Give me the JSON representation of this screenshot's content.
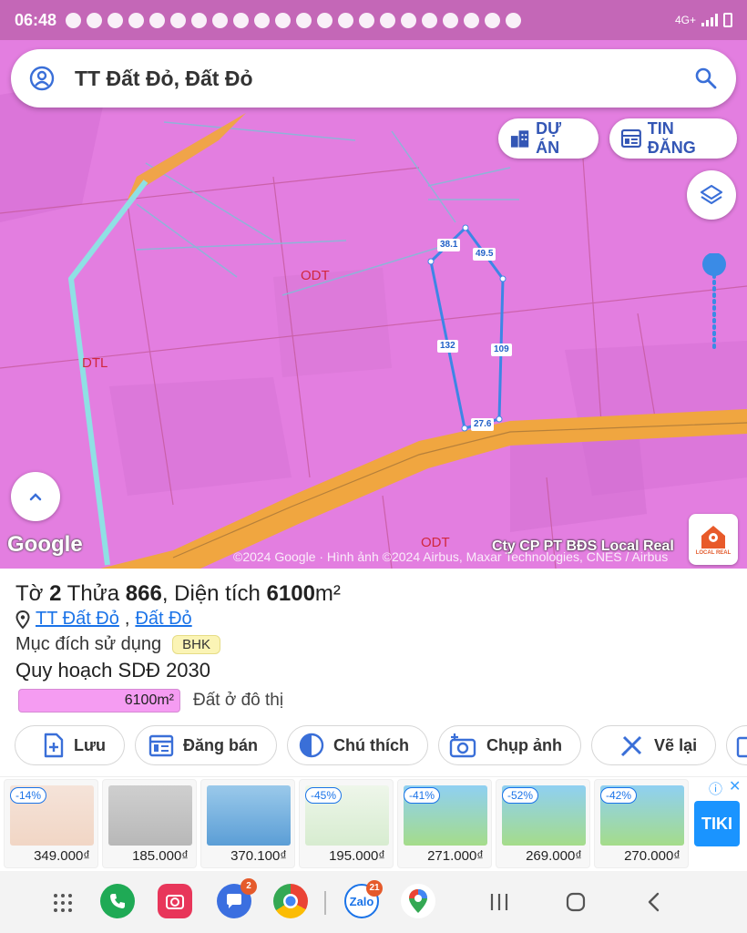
{
  "status_bar": {
    "time": "06:48",
    "network": "4G+"
  },
  "search": {
    "query": "TT Đất Đỏ, Đất Đỏ"
  },
  "top_buttons": {
    "du_an": "DỰ ÁN",
    "tin_dang": "TIN ĐĂNG"
  },
  "map": {
    "zone_labels": [
      "ODT",
      "DTL",
      "ODT"
    ],
    "segment_labels": [
      "38.1",
      "49.5",
      "132",
      "109",
      "27.6"
    ],
    "google": "Google",
    "attribution": "©2024 Google · Hình ảnh ©2024 Airbus, Maxar Technologies, CNES / Airbus",
    "watermark": "Cty CP PT BĐS Local Real",
    "logo_text": "LOCAL REAL"
  },
  "parcel": {
    "to_label": "Tờ",
    "to_value": "2",
    "thua_label": "Thửa",
    "thua_value": "866",
    "area_label": ", Diện tích",
    "area_value": "6100",
    "area_unit": "m²",
    "location_1": "TT Đất Đỏ",
    "location_sep": ",",
    "location_2": "Đất Đỏ",
    "purpose_label": "Mục đích sử dụng",
    "purpose_value": "BHK",
    "plan_label": "Quy hoạch SDĐ 2030",
    "legend_area": "6100m²",
    "legend_desc": "Đất ở đô thị",
    "legend_color": "#f59cf2"
  },
  "actions": [
    "Lưu",
    "Đăng bán",
    "Chú thích",
    "Chụp ảnh",
    "Vẽ lại"
  ],
  "ads": [
    {
      "discount": "-14%",
      "price": "349.000₫"
    },
    {
      "discount": "",
      "price": "185.000₫"
    },
    {
      "discount": "",
      "price": "370.100₫"
    },
    {
      "discount": "-45%",
      "price": "195.000₫"
    },
    {
      "discount": "-41%",
      "price": "271.000₫"
    },
    {
      "discount": "-52%",
      "price": "269.000₫"
    },
    {
      "discount": "-42%",
      "price": "270.000₫"
    }
  ],
  "ad_brand": "TIKI",
  "dock": {
    "messages_badge": "2",
    "zalo_label": "Zalo",
    "zalo_badge": "21"
  },
  "colors": {
    "zone_pink": "#e37ee0",
    "road_orange": "#f0a640",
    "accent_blue": "#1a73e8",
    "parcel_outline": "#3d86e6"
  }
}
